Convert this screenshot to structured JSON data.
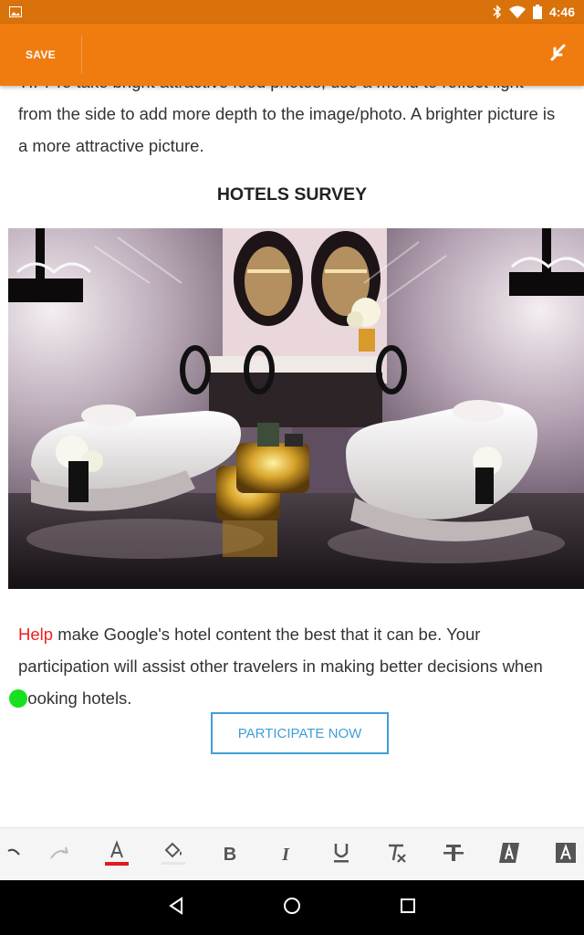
{
  "status_bar": {
    "time": "4:46"
  },
  "toolbar": {
    "save_label": "SAVE"
  },
  "content": {
    "tip_partial": "TIP: To take bright attractive food photos, use a menu to reflect light",
    "tip_rest": "from the side to add more depth to the image/photo. A brighter picture is a more attractive picture.",
    "survey_title": "HOTELS SURVEY",
    "help_word": "Help",
    "help_rest": " make Google's hotel content the best that it can be. Your participation will assist other travelers in making better decisions when booking hotels.",
    "participate_label": "PARTICIPATE NOW"
  },
  "format_bar": {
    "text_color_underline": "#e11a1a",
    "tools": [
      "undo",
      "redo",
      "text-color",
      "fill-color",
      "bold",
      "italic",
      "underline",
      "clear-format",
      "strikethrough",
      "text-style",
      "text-background"
    ]
  },
  "colors": {
    "status_bar": "#d9720b",
    "toolbar": "#f07c10",
    "link_red": "#ee1f1f",
    "button_blue": "#3f9fd6",
    "cursor_green": "#17e01f"
  }
}
